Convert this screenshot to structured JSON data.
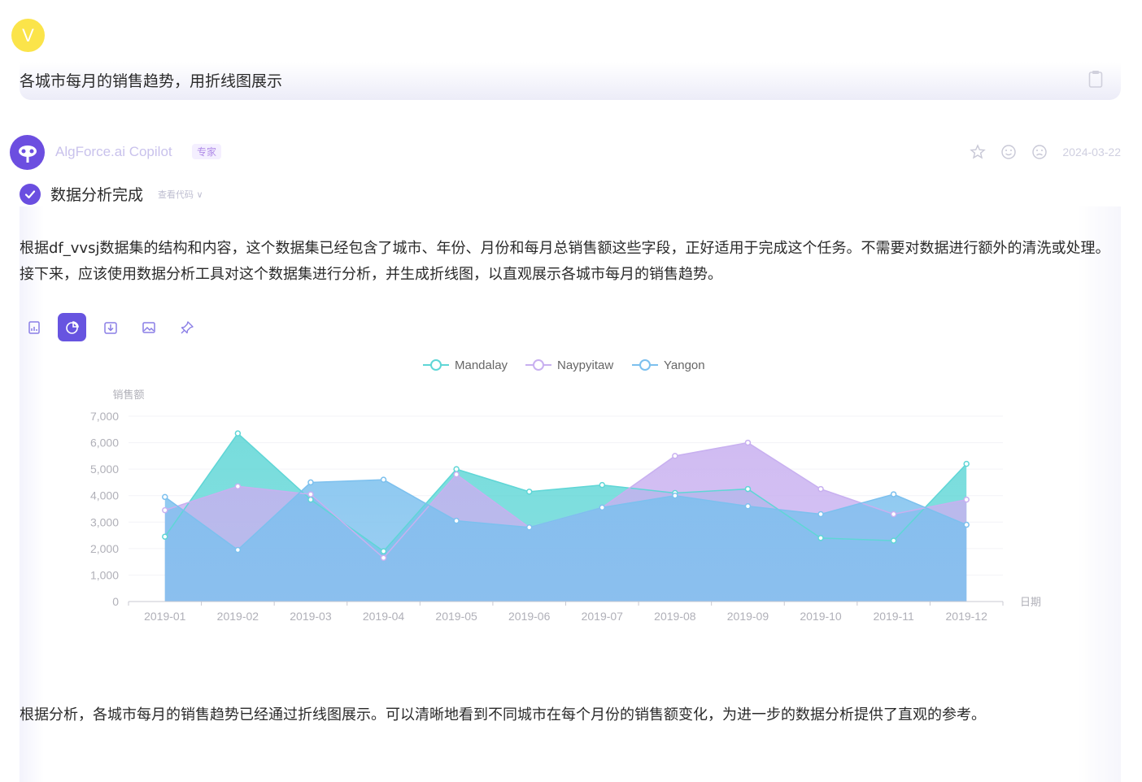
{
  "user": {
    "avatar_letter": "V",
    "message": "各城市每月的销售趋势，用折线图展示"
  },
  "bot": {
    "name": "AlgForce.ai Copilot",
    "badge": "专家",
    "date": "2024-03-22",
    "status": "数据分析完成",
    "view_code": "查看代码 ∨",
    "paragraph1": "根据df_vvsj数据集的结构和内容，这个数据集已经包含了城市、年份、月份和每月总销售额这些字段，正好适用于完成这个任务。不需要对数据进行额外的清洗或处理。接下来，应该使用数据分析工具对这个数据集进行分析，并生成折线图，以直观展示各城市每月的销售趋势。",
    "paragraph2": "根据分析，各城市每月的销售趋势已经通过折线图展示。可以清晰地看到不同城市在每个月份的销售额变化，为进一步的数据分析提供了直观的参考。"
  },
  "toolbar": [
    "table-icon",
    "chart-icon",
    "download-icon",
    "image-icon",
    "pin-icon"
  ],
  "colors": {
    "accent": "#6754e0",
    "mandalay": "#5fd6d6",
    "naypyitaw": "#c8b0f0",
    "yangon": "#7cc0ee"
  },
  "chart_data": {
    "type": "area",
    "categories": [
      "2019-01",
      "2019-02",
      "2019-03",
      "2019-04",
      "2019-05",
      "2019-06",
      "2019-07",
      "2019-08",
      "2019-09",
      "2019-10",
      "2019-11",
      "2019-12"
    ],
    "series": [
      {
        "name": "Mandalay",
        "values": [
          2450,
          6350,
          3850,
          1900,
          5000,
          4150,
          4400,
          4100,
          4250,
          2400,
          2300,
          5200
        ]
      },
      {
        "name": "Naypyitaw",
        "values": [
          3450,
          4350,
          4050,
          1650,
          4800,
          2800,
          3550,
          5500,
          6000,
          4250,
          3300,
          3850
        ]
      },
      {
        "name": "Yangon",
        "values": [
          3950,
          1950,
          4500,
          4600,
          3050,
          2800,
          3550,
          4000,
          3600,
          3300,
          4050,
          2900
        ]
      }
    ],
    "ylabel": "销售额",
    "xlabel": "日期",
    "ylim": [
      0,
      7000
    ],
    "yticks": [
      "0",
      "1,000",
      "2,000",
      "3,000",
      "4,000",
      "5,000",
      "6,000",
      "7,000"
    ],
    "legend_position": "top-center"
  }
}
